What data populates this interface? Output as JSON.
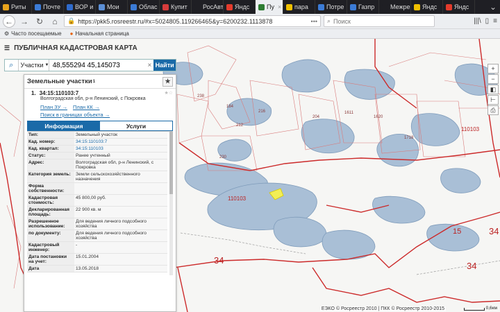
{
  "browser": {
    "tabs": [
      {
        "label": "Риты",
        "color": "#e8a31c"
      },
      {
        "label": "Почте",
        "color": "#3b7bd6"
      },
      {
        "label": "ВОР и",
        "color": "#2f6bcc"
      },
      {
        "label": "Мои",
        "color": "#5b8fd6"
      },
      {
        "label": "Облас",
        "color": "#3b7bd6"
      },
      {
        "label": "Купит",
        "color": "#d63b3b"
      },
      {
        "label": "РосАвтоН",
        "color": "#1f1f24"
      },
      {
        "label": "Яндс",
        "color": "#e43b2c"
      },
      {
        "label": "Пу",
        "color": "#2e7d32",
        "active": true
      },
      {
        "label": "пара",
        "color": "#f0c000"
      },
      {
        "label": "Потре",
        "color": "#3b7bd6"
      },
      {
        "label": "Газпр",
        "color": "#3b7bd6"
      },
      {
        "label": "Межрегис",
        "color": "#1f1f24"
      },
      {
        "label": "Яндс",
        "color": "#f0c000"
      },
      {
        "label": "Яндс",
        "color": "#e43b2c"
      }
    ],
    "url": "https://pkk5.rosreestr.ru/#x=5024805.119266465&y=6200232.1113878",
    "url_more": "•••",
    "search_placeholder": "Поиск",
    "bookmarks": [
      "Часто посещаемые",
      "Начальная страница"
    ]
  },
  "app": {
    "title": "ПУБЛИЧНАЯ КАДАСТРОВАЯ КАРТА",
    "search_type": "Участки",
    "search_value": "48,555294 45,145073",
    "find_label": "Найти"
  },
  "panel": {
    "title": "Земельные участки",
    "count": "1",
    "item_number": "1.",
    "cad_number": "34:15:110103:7",
    "address": "Волгоградская обл, р-н Ленинский, с Покровка",
    "links": [
      "План ЗУ →",
      "План КК →",
      "Поиск в границах объекта →"
    ],
    "tab_info": "Информация",
    "tab_services": "Услуги",
    "attrs": [
      {
        "k": "Тип:",
        "v": "Земельный участок"
      },
      {
        "k": "Кад. номер:",
        "v": "34:15:110103:7",
        "link": true
      },
      {
        "k": "Кад. квартал:",
        "v": "34:15:110103",
        "link": true
      },
      {
        "k": "Статус:",
        "v": "Ранее учтенный"
      },
      {
        "k": "Адрес:",
        "v": "Волгоградская обл, р-н Ленинский, с Покровка"
      },
      {
        "k": "Категория земель:",
        "v": "Земли сельскохозяйственного назначения"
      },
      {
        "k": "Форма собственности:",
        "v": ""
      },
      {
        "k": "Кадастровая стоимость:",
        "v": "45 800,00 руб."
      },
      {
        "k": "Декларированная площадь:",
        "v": "22 900 кв. м"
      },
      {
        "k": "Разрешенное использование:",
        "v": "Для ведения личного подсобного хозяйства"
      },
      {
        "k": "по документу:",
        "v": "Для ведения личного подсобного хозяйства"
      },
      {
        "k": "Кадастровый инженер:",
        "v": "-"
      },
      {
        "k": "Дата постановки на учет:",
        "v": "15.01.2004"
      },
      {
        "k": "Дата",
        "v": "13.05.2018"
      }
    ]
  },
  "map": {
    "parcel_labels": [
      "238",
      "184",
      "212",
      "216",
      "204",
      "1611",
      "1620",
      "1718",
      "230",
      "110103",
      "110103",
      "15",
      "34",
      "34",
      "34"
    ],
    "attribution": "ЕЭКО © Росреестр 2010 | ПКК © Росреестр 2010-2015",
    "scale": "0,6км"
  }
}
